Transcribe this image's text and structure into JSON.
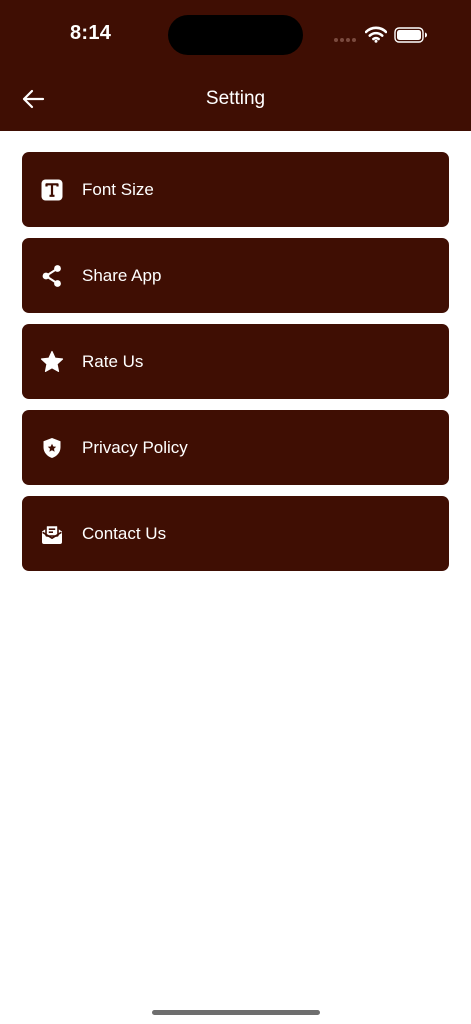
{
  "status_bar": {
    "time": "8:14"
  },
  "header": {
    "title": "Setting"
  },
  "menu": {
    "items": [
      {
        "label": "Font Size",
        "icon": "font-size-icon"
      },
      {
        "label": "Share App",
        "icon": "share-icon"
      },
      {
        "label": "Rate Us",
        "icon": "star-icon"
      },
      {
        "label": "Privacy Policy",
        "icon": "shield-icon"
      },
      {
        "label": "Contact Us",
        "icon": "mail-icon"
      }
    ]
  },
  "colors": {
    "primary": "#3f0e03",
    "background": "#ffffff",
    "text_on_primary": "#ffffff"
  }
}
